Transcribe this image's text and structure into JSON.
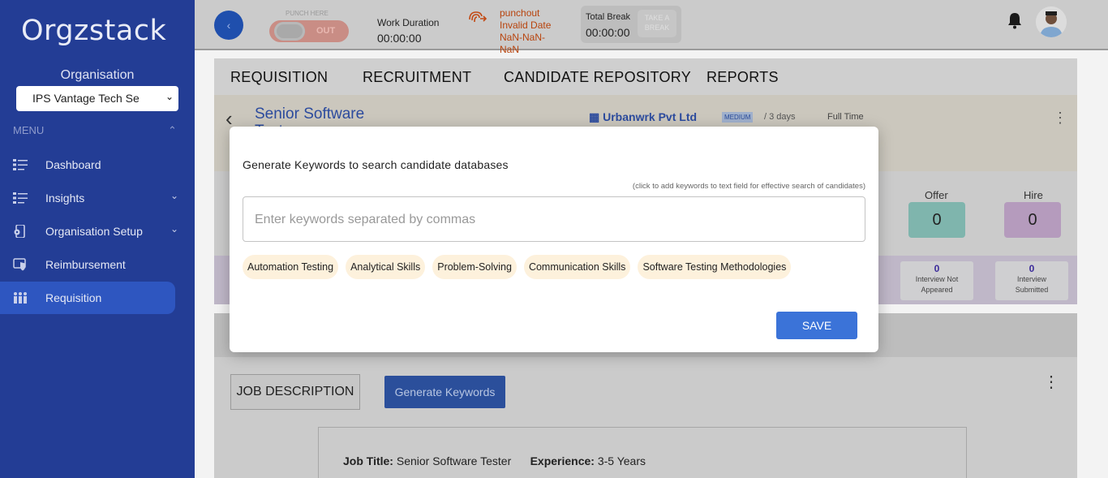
{
  "sidebar": {
    "logo_text": "Orgzstack",
    "org_label": "Organisation",
    "org_selected": "IPS Vantage Tech Se",
    "menu_label": "MENU",
    "items": [
      {
        "label": "Dashboard",
        "icon": "list-icon"
      },
      {
        "label": "Insights",
        "icon": "list-icon"
      },
      {
        "label": "Organisation Setup",
        "icon": "device-gear-icon"
      },
      {
        "label": "Reimbursement",
        "icon": "shield-money-icon"
      },
      {
        "label": "Requisition",
        "icon": "people-icon"
      }
    ]
  },
  "topbar": {
    "back_glyph": "‹",
    "punch_here": "PUNCH HERE",
    "punch_state": "OUT",
    "work_duration_label": "Work Duration",
    "work_duration_value": "00:00:00",
    "punchout_lines": [
      "punchout",
      "Invalid Date",
      "NaN-NaN-",
      "NaN"
    ],
    "total_break_label": "Total Break",
    "total_break_value": "00:00:00",
    "take_break_label": "TAKE A BREAK"
  },
  "tabs": [
    "REQUISITION",
    "RECRUITMENT",
    "CANDIDATE REPOSITORY",
    "REPORTS"
  ],
  "job": {
    "title_line1": "Senior Software",
    "title_line2": "Tester",
    "company": "Urbanwrk Pvt Ltd",
    "priority": "MEDIUM",
    "days": "/ 3 days",
    "employment_type": "Full Time"
  },
  "stats": [
    {
      "label": "Offer",
      "value": "0",
      "color": "#7fb5ad"
    },
    {
      "label": "Hire",
      "value": "0",
      "color": "#b59bbd"
    }
  ],
  "interviews": [
    {
      "value": "0",
      "label_lines": [
        "Interview Not",
        "Appeared"
      ]
    },
    {
      "value": "0",
      "label_lines": [
        "Interview",
        "Submitted"
      ]
    }
  ],
  "lower": {
    "jd_tab": "JOB DESCRIPTION",
    "generate_button": "Generate Keywords",
    "job_title_label": "Job Title:",
    "job_title_value": "Senior Software Tester",
    "experience_label": "Experience:",
    "experience_value": "3-5 Years"
  },
  "modal": {
    "title": "Generate Keywords to search candidate databases",
    "hint": "(click to add keywords to text field for effective search of candidates)",
    "input_placeholder": "Enter keywords separated by commas",
    "chips": [
      "Automation Testing",
      "Analytical Skills",
      "Problem-Solving",
      "Communication Skills",
      "Software Testing Methodologies"
    ],
    "save_label": "SAVE"
  },
  "colors": {
    "sidebar": "#233d95",
    "accent": "#3b73d8",
    "chip_bg": "#fdf1dc"
  }
}
